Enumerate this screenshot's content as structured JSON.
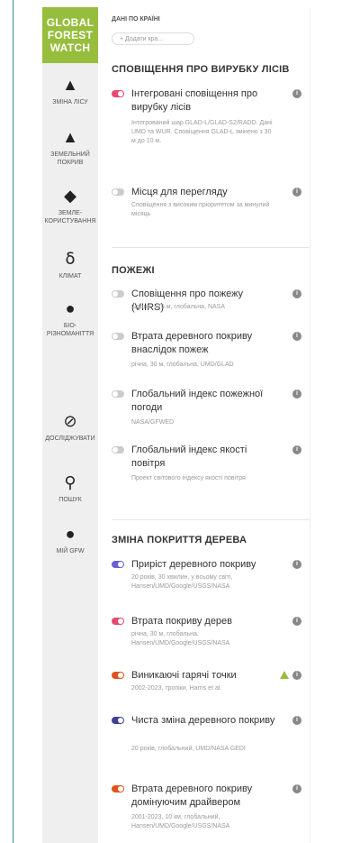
{
  "brand": {
    "line1": "GLOBAL",
    "line2": "FOREST",
    "line3": "WATCH"
  },
  "nav": [
    {
      "label": "ЗМІНА ЛІСУ",
      "icon": "forest-change-icon"
    },
    {
      "label": "ЗЕМЕЛЬНИЙ ПОКРИВ",
      "icon": "land-cover-icon"
    },
    {
      "label": "ЗЕМЛЕ-КОРИСТУВАННЯ",
      "icon": "land-use-icon"
    },
    {
      "label": "КЛІМАТ",
      "icon": "thermometer-icon"
    },
    {
      "label": "БІО-РІЗНОМАНІТТЯ",
      "icon": "paw-icon"
    },
    {
      "label": "ДОСЛІДЖУВАТИ",
      "icon": "compass-icon"
    },
    {
      "label": "ПОШУК",
      "icon": "search-icon"
    },
    {
      "label": "МІЙ GFW",
      "icon": "user-icon"
    }
  ],
  "country": {
    "label": "ДАНІ ПО КРАЇНІ",
    "placeholder": "+ Додати кра..."
  },
  "sections": [
    {
      "title": "СПОВІЩЕННЯ ПРО ВИРУБКУ ЛІСІВ",
      "layers": [
        {
          "name": "Інтегровані сповіщення про вирубку лісів",
          "desc": "Інтегрований шар GLAD-L/GLAD-S2/RADD. Дані UMD та WUR. Сповіщення GLAD-L змінено з 30 м до 10 м.",
          "on": true,
          "color": "#e74a6f"
        },
        {
          "name": "Місця для перегляду",
          "desc": "Сповіщення з високим пріоритетом за минулий місяць",
          "on": false,
          "color": "#cccccc"
        }
      ]
    },
    {
      "title": "ПОЖЕЖІ",
      "layers": [
        {
          "name": "Сповіщення про пожежу (VIIRS)",
          "desc": "щодня, 375 м, глобальна, NASA",
          "on": false,
          "color": "#cccccc"
        },
        {
          "name": "Втрата деревного покриву внаслідок пожеж",
          "desc": "річна, 30 м, глобальна, UMD/GLAD",
          "on": false,
          "color": "#cccccc"
        },
        {
          "name": "Глобальний індекс пожежної погоди",
          "desc": "NASA/GFWED",
          "on": false,
          "color": "#cccccc"
        },
        {
          "name": "Глобальний індекс якості повітря",
          "desc": "Проект світового індексу якості повітря",
          "on": false,
          "color": "#cccccc"
        }
      ]
    },
    {
      "title": "ЗМІНА ПОКРИТТЯ ДЕРЕВА",
      "layers": [
        {
          "name": "Приріст деревного покриву",
          "desc": "20 років, 30 хвилин, у всьому світі, Hansen/UMD/Google/USGS/NASA",
          "on": true,
          "color": "#6a5fd8"
        },
        {
          "name": "Втрата покриву дерев",
          "desc": "річна, 30 м, глобальна, Hansen/UMD/Google/USGS/NASA",
          "on": true,
          "color": "#e74a6f"
        },
        {
          "name": "Виникаючі гарячі точки",
          "desc": "2002-2023, тропіки, Harris et al.",
          "on": true,
          "color": "#e0541c",
          "warning": true
        },
        {
          "name": "Чиста зміна деревного покриву",
          "desc": "20 років, глобальний, UMD/NASA GEDI",
          "on": true,
          "color": "#3f3f9a"
        },
        {
          "name": "Втрата деревного покриву домінуючим драйвером",
          "desc": "2001-2023, 10 км, глобальний, Hansen/UMD/Google/USGS/NASA",
          "on": true,
          "color": "#e0541c"
        }
      ]
    }
  ]
}
